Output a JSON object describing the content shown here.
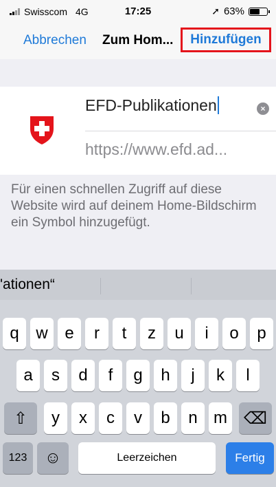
{
  "status": {
    "carrier": "Swisscom",
    "network": "4G",
    "time": "17:25",
    "battery": "63%",
    "battery_level": 0.63
  },
  "nav": {
    "cancel": "Abbrechen",
    "title": "Zum Hom...",
    "add": "Hinzufügen"
  },
  "form": {
    "name_value": "EFD-Publikationen",
    "url_value": "https://www.efd.ad...",
    "clear_symbol": "×"
  },
  "description": "Für einen schnellen Zugriff auf diese Website wird auf deinem Home-Bildschirm ein Symbol hinzugefügt.",
  "keyboard": {
    "suggestion": "'ationen“",
    "row1": [
      "q",
      "w",
      "e",
      "r",
      "t",
      "z",
      "u",
      "i",
      "o",
      "p"
    ],
    "row2": [
      "a",
      "s",
      "d",
      "f",
      "g",
      "h",
      "j",
      "k",
      "l"
    ],
    "row3": [
      "y",
      "x",
      "c",
      "v",
      "b",
      "n",
      "m"
    ],
    "shift": "⇧",
    "backspace": "⌫",
    "numbers": "123",
    "emoji": "☺",
    "space": "Leerzeichen",
    "done": "Fertig"
  },
  "colors": {
    "accent": "#1f7ad8",
    "highlight_border": "#e4141b",
    "logo_red": "#e4141b"
  }
}
